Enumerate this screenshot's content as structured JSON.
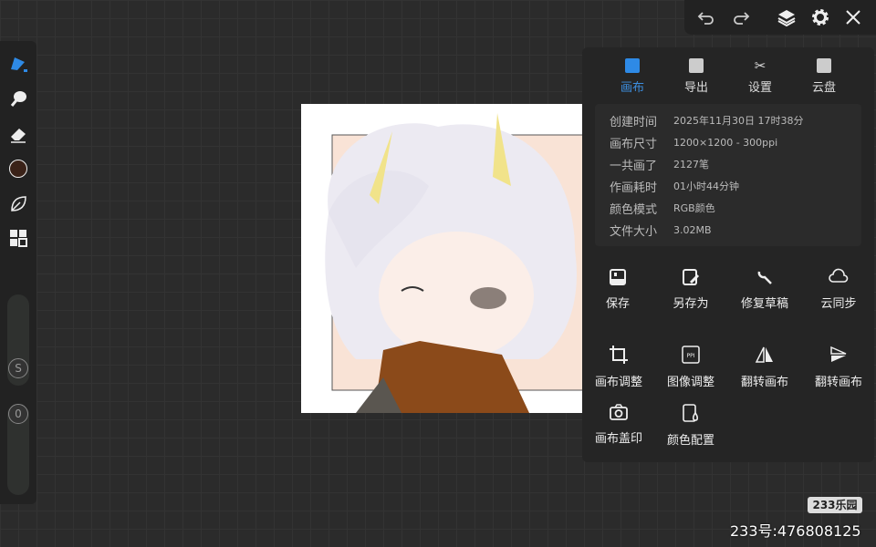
{
  "left_toolbar": {
    "tools": [
      "brush",
      "smudge",
      "eraser",
      "color",
      "leaf",
      "grid"
    ],
    "current_color": "#3a2218",
    "size_label": "S",
    "opacity_label": "0"
  },
  "top_toolbar": {
    "buttons": [
      "undo",
      "redo",
      "layers",
      "settings",
      "close"
    ]
  },
  "panel": {
    "tabs": [
      {
        "label": "画布",
        "active": true
      },
      {
        "label": "导出"
      },
      {
        "label": "设置"
      },
      {
        "label": "云盘"
      }
    ],
    "info": [
      {
        "key": "创建时间",
        "value": "2025年11月30日 17时38分"
      },
      {
        "key": "画布尺寸",
        "value": "1200×1200 - 300ppi"
      },
      {
        "key": "一共画了",
        "value": "2127笔"
      },
      {
        "key": "作画耗时",
        "value": "01小时44分钟"
      },
      {
        "key": "颜色模式",
        "value": "RGB颜色"
      },
      {
        "key": "文件大小",
        "value": "3.02MB"
      }
    ],
    "actions": [
      {
        "label": "保存"
      },
      {
        "label": "另存为"
      },
      {
        "label": "修复草稿"
      },
      {
        "label": "云同步"
      },
      {
        "label": "画布调整"
      },
      {
        "label": "图像调整"
      },
      {
        "label": "翻转画布"
      },
      {
        "label": "翻转画布"
      },
      {
        "label": "画布盖印"
      },
      {
        "label": "颜色配置"
      }
    ]
  },
  "watermark": {
    "badge": "233乐园",
    "id_text": "233号:476808125"
  },
  "colors": {
    "accent": "#2e8ae6",
    "panel": "#252525"
  }
}
